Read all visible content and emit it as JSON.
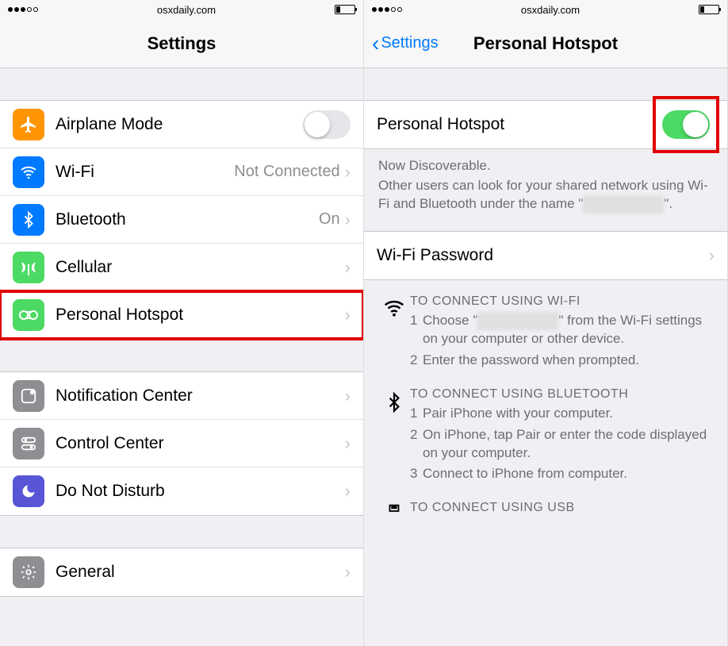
{
  "status_bar": {
    "domain": "osxdaily.com"
  },
  "left": {
    "title": "Settings",
    "rows": {
      "airplane": {
        "label": "Airplane Mode"
      },
      "wifi": {
        "label": "Wi-Fi",
        "value": "Not Connected"
      },
      "bluetooth": {
        "label": "Bluetooth",
        "value": "On"
      },
      "cellular": {
        "label": "Cellular"
      },
      "hotspot": {
        "label": "Personal Hotspot"
      },
      "notif": {
        "label": "Notification Center"
      },
      "control": {
        "label": "Control Center"
      },
      "dnd": {
        "label": "Do Not Disturb"
      },
      "general": {
        "label": "General"
      }
    }
  },
  "right": {
    "back_label": "Settings",
    "title": "Personal Hotspot",
    "toggle_row": {
      "label": "Personal Hotspot"
    },
    "discover_title": "Now Discoverable.",
    "discover_body_pre": "Other users can look for your shared network using Wi-Fi and Bluetooth under the name \"",
    "discover_body_post": "\".",
    "wifi_pwd_row": {
      "label": "Wi-Fi Password"
    },
    "instr": {
      "wifi": {
        "title": "TO CONNECT USING WI-FI",
        "s1a": "Choose \"",
        "s1b": "\" from the Wi-Fi settings on your computer or other device.",
        "s2": "Enter the password when prompted."
      },
      "bt": {
        "title": "TO CONNECT USING BLUETOOTH",
        "s1": "Pair iPhone with your computer.",
        "s2": "On iPhone, tap Pair or enter the code displayed on your computer.",
        "s3": "Connect to iPhone from computer."
      },
      "usb": {
        "title": "TO CONNECT USING USB"
      }
    }
  }
}
